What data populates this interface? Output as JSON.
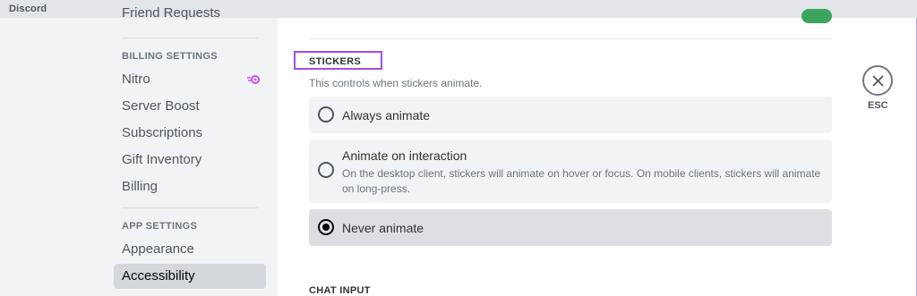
{
  "window": {
    "title": "Discord"
  },
  "sidebar": {
    "items_top": [
      {
        "label": "Friend Requests"
      }
    ],
    "billing": {
      "header": "BILLING SETTINGS",
      "items": [
        {
          "label": "Nitro"
        },
        {
          "label": "Server Boost"
        },
        {
          "label": "Subscriptions"
        },
        {
          "label": "Gift Inventory"
        },
        {
          "label": "Billing"
        }
      ]
    },
    "app": {
      "header": "APP SETTINGS",
      "items": [
        {
          "label": "Appearance"
        },
        {
          "label": "Accessibility",
          "selected": true
        }
      ]
    }
  },
  "main": {
    "stickers": {
      "title": "STICKERS",
      "description": "This controls when stickers animate.",
      "options": [
        {
          "label": "Always animate",
          "selected": false
        },
        {
          "label": "Animate on interaction",
          "description": "On the desktop client, stickers will animate on hover or focus. On mobile clients, stickers will animate on long-press.",
          "selected": false
        },
        {
          "label": "Never animate",
          "selected": true
        }
      ]
    },
    "next_section": {
      "title": "CHAT INPUT"
    }
  },
  "close": {
    "label": "ESC"
  },
  "colors": {
    "accent_highlight": "#a44ee6",
    "toggle_on": "#3ba55d",
    "nitro_pink": "#c94ff6"
  }
}
